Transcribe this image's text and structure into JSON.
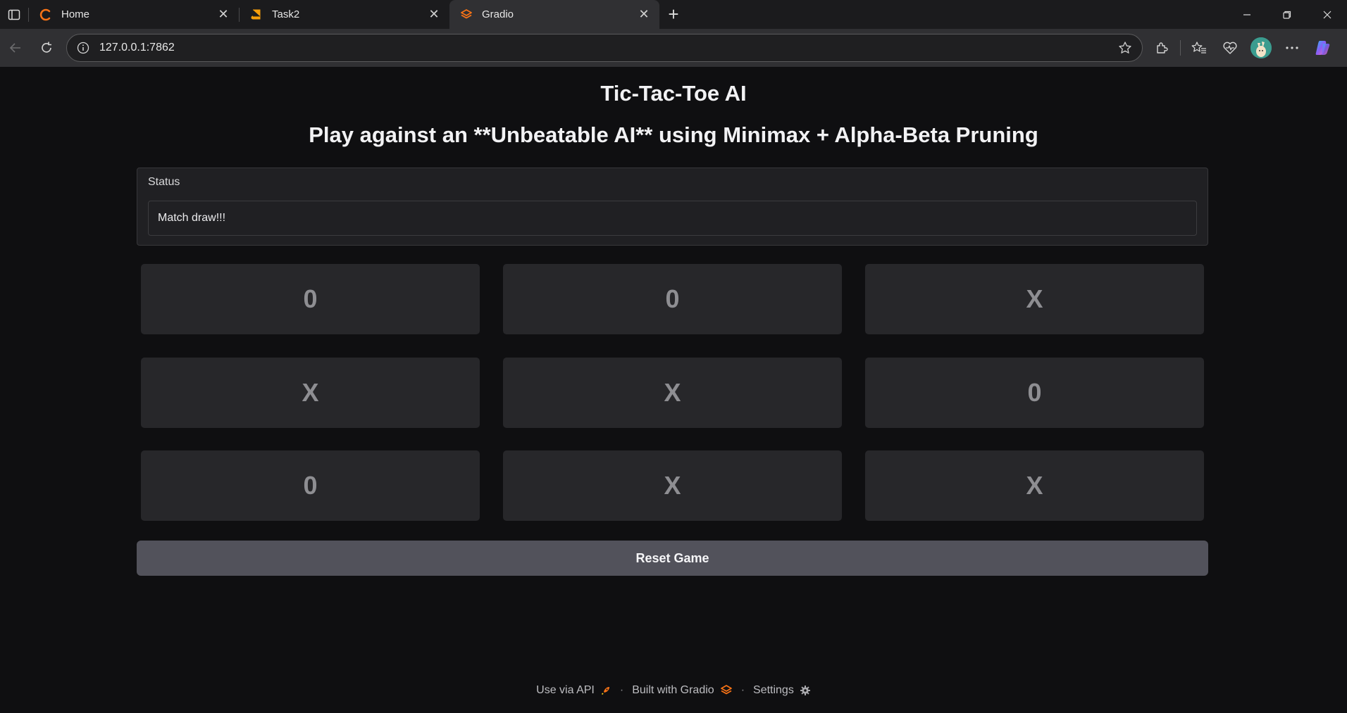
{
  "browser": {
    "tabs": [
      {
        "title": "Home",
        "icon": "home-ring-icon",
        "active": false
      },
      {
        "title": "Task2",
        "icon": "book-icon",
        "active": false
      },
      {
        "title": "Gradio",
        "icon": "gradio-icon",
        "active": true
      }
    ],
    "url": "127.0.0.1:7862"
  },
  "app": {
    "title": "Tic-Tac-Toe AI",
    "subtitle": "Play against an **Unbeatable AI** using Minimax + Alpha-Beta Pruning",
    "status": {
      "label": "Status",
      "value": "Match draw!!!"
    },
    "board": [
      "0",
      "0",
      "X",
      "X",
      "X",
      "0",
      "0",
      "X",
      "X"
    ],
    "reset_label": "Reset Game"
  },
  "footer": {
    "api_label": "Use via API",
    "built_label": "Built with Gradio",
    "settings_label": "Settings",
    "separator": "·"
  },
  "colors": {
    "accent_orange": "#f97316",
    "page_bg": "#0f0f11",
    "cell_bg": "#27272a",
    "button_bg": "#52525b"
  }
}
